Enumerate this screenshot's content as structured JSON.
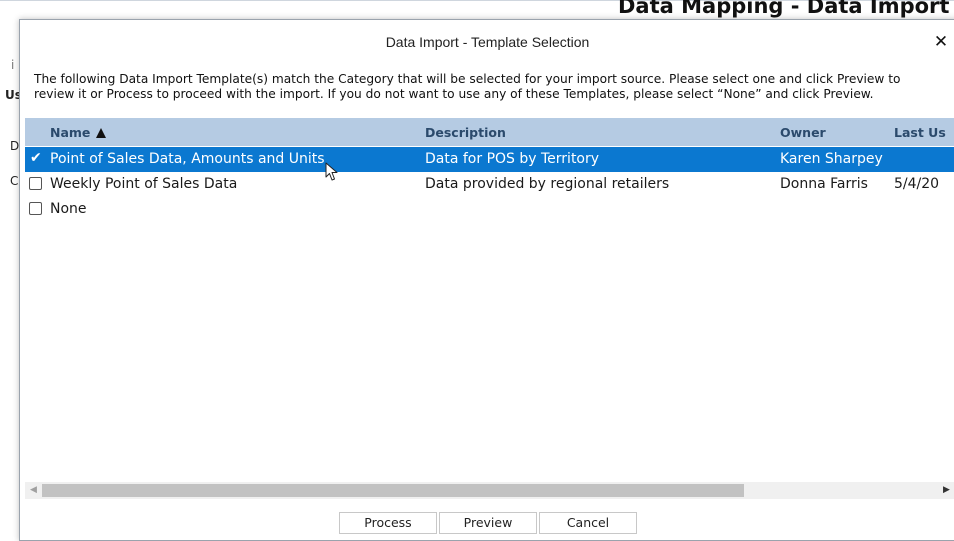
{
  "background": {
    "page_title": "Data Mapping - Data Import",
    "fragments": [
      "i",
      "Us",
      "D",
      "C"
    ]
  },
  "dialog": {
    "title": "Data Import - Template Selection",
    "close_icon": "close-icon",
    "description": "The following Data Import Template(s) match the Category that will be selected for your import source. Please select one and click Preview to review it or Process to proceed with the import. If you do not want to use any of these Templates, please select “None” and click Preview.",
    "columns": {
      "name": "Name",
      "description": "Description",
      "owner": "Owner",
      "last_used": "Last Us"
    },
    "sort": {
      "column": "Name",
      "direction": "ascending",
      "icon": "sort-ascending-icon"
    },
    "rows": [
      {
        "name": "Point of Sales Data, Amounts and Units",
        "description": "Data for POS by Territory",
        "owner": "Karen Sharpey",
        "last_used": "",
        "selected": true
      },
      {
        "name": "Weekly Point of Sales Data",
        "description": "Data provided by regional retailers",
        "owner": "Donna Farris",
        "last_used": "5/4/20",
        "selected": false
      },
      {
        "name": "None",
        "description": "",
        "owner": "",
        "last_used": "",
        "selected": false
      }
    ],
    "buttons": {
      "process": "Process",
      "preview": "Preview",
      "cancel": "Cancel"
    }
  },
  "colors": {
    "header_bg": "#b5cbe3",
    "header_text": "#2b4a6c",
    "selected_row": "#0b78d0"
  }
}
